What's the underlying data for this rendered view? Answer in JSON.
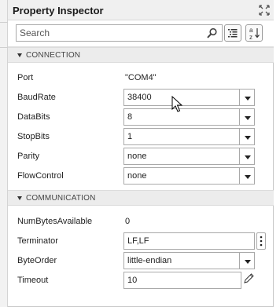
{
  "panel": {
    "title": "Property Inspector",
    "icons": {
      "undock": "undock-icon",
      "search": "search-icon",
      "categorize": "categorize-icon",
      "sort": "sort-az-icon"
    }
  },
  "search": {
    "placeholder": "Search",
    "value": ""
  },
  "sections": {
    "connection": {
      "label": "CONNECTION",
      "properties": {
        "port": {
          "label": "Port",
          "value": "\"COM4\""
        },
        "baudrate": {
          "label": "BaudRate",
          "value": "38400"
        },
        "databits": {
          "label": "DataBits",
          "value": "8"
        },
        "stopbits": {
          "label": "StopBits",
          "value": "1"
        },
        "parity": {
          "label": "Parity",
          "value": "none"
        },
        "flowcontrol": {
          "label": "FlowControl",
          "value": "none"
        }
      }
    },
    "communication": {
      "label": "COMMUNICATION",
      "properties": {
        "numbytes": {
          "label": "NumBytesAvailable",
          "value": "0"
        },
        "terminator": {
          "label": "Terminator",
          "value": "LF,LF"
        },
        "byteorder": {
          "label": "ByteOrder",
          "value": "little-endian"
        },
        "timeout": {
          "label": "Timeout",
          "value": "10"
        }
      }
    }
  },
  "colors": {
    "section_header_bg": "#ececec",
    "titlebar_bg": "#f0f0f0",
    "field_border": "#a9a9a9"
  }
}
